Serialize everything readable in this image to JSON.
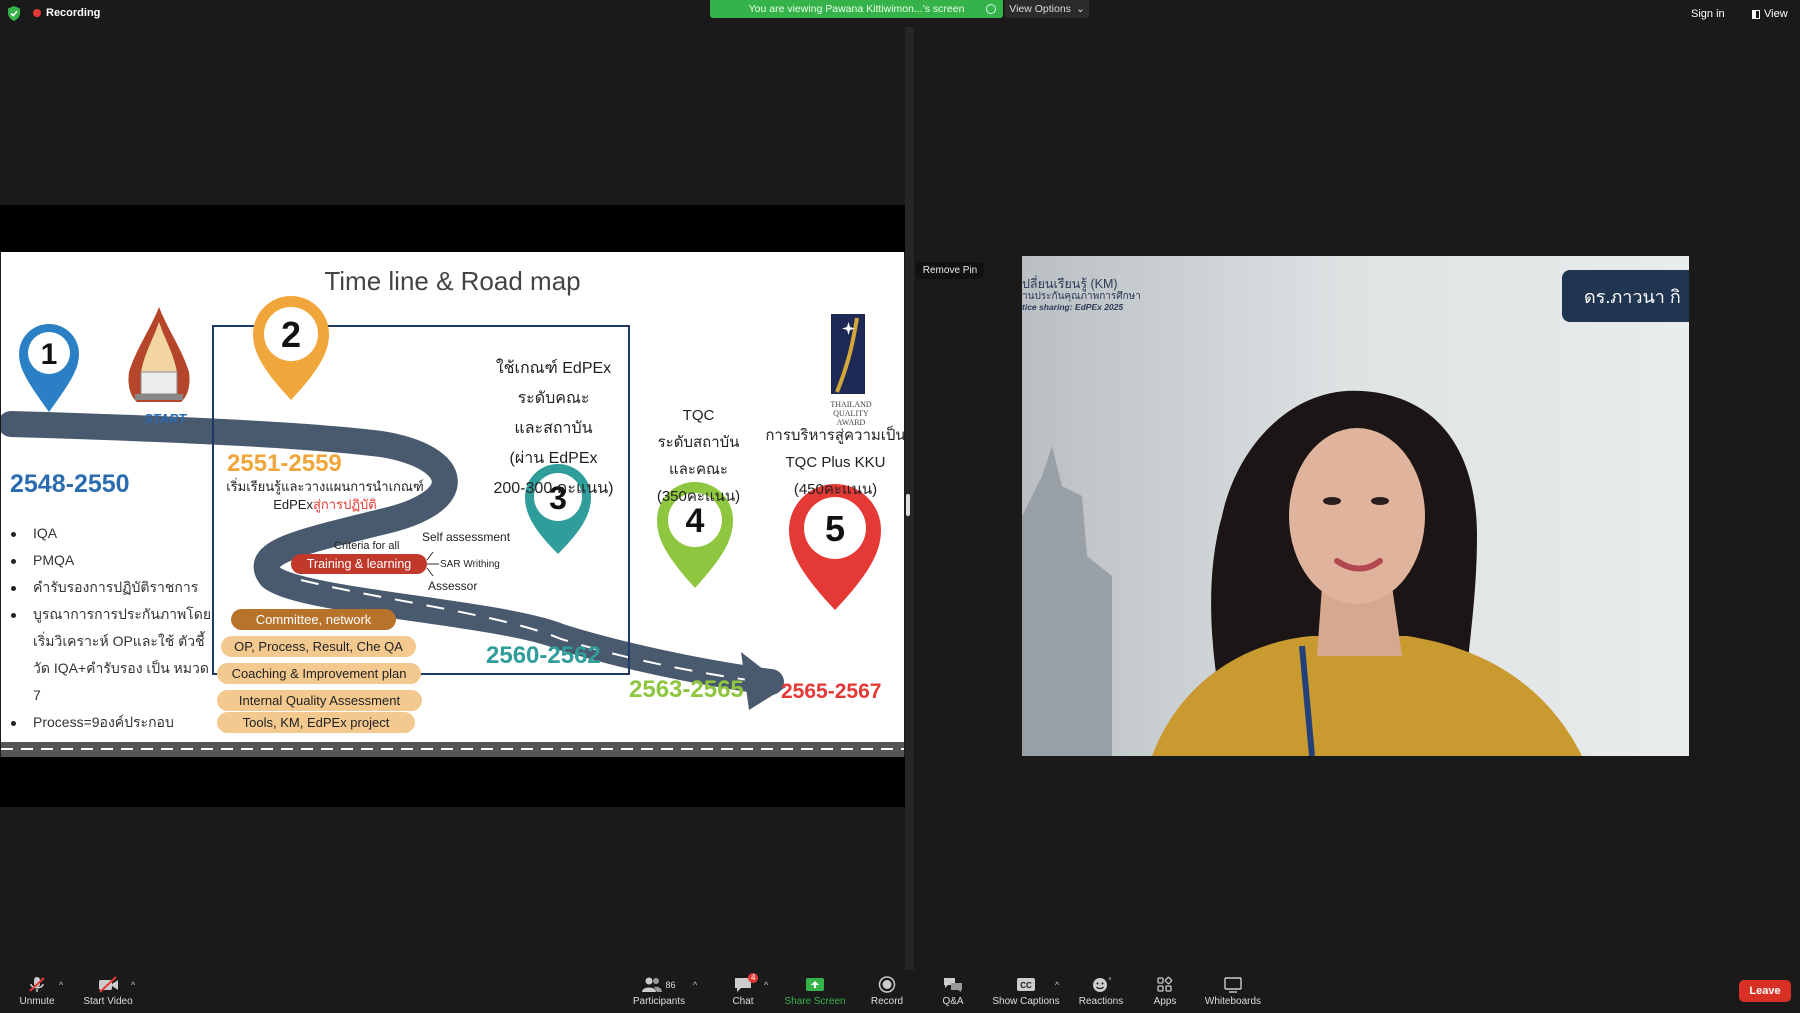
{
  "topbar": {
    "recording": "Recording",
    "viewing_notice": "You are viewing Pawana Kittiwimon...'s screen",
    "view_options": "View Options",
    "sign_in": "Sign in",
    "view": "View"
  },
  "slide": {
    "title": "Time line & Road map",
    "start_label": "START",
    "pins": [
      "1",
      "2",
      "3",
      "4",
      "5"
    ],
    "period1": {
      "years": "2548-2550",
      "bullets": [
        "IQA",
        "PMQA",
        "คำรับรองการปฏิบัติราชการ",
        "บูรณาการการประกันภาพโดยเริ่มวิเคราะห์ OPและใช้ ตัวชี้วัด IQA+คำรับรอง เป็น หมวด 7",
        "Process=9องค์ประกอบ"
      ]
    },
    "period2": {
      "years": "2551-2559",
      "text_a": "เริ่มเรียนรู้และวางแผนการนำเกณฑ์ EdPEx",
      "text_b": "สู่การปฏิบัติ",
      "criteria": "Criteria for all",
      "training": "Training & learning",
      "self_assessment": "Self assessment",
      "sar": "SAR Writhing",
      "assessor": "Assessor",
      "ovals": [
        "Committee, network",
        "OP, Process, Result, Che QA",
        "Coaching & Improvement plan",
        "Internal Quality Assessment",
        "Tools, KM, EdPEx project"
      ]
    },
    "period3": {
      "years": "2560-2562",
      "lines": [
        "ใช้เกณฑ์ EdPEx",
        "ระดับคณะ",
        "และสถาบัน",
        "(ผ่าน EdPEx",
        "200-300 คะแนน)"
      ]
    },
    "period4": {
      "years": "2563-2565",
      "lines": [
        "TQC",
        "ระดับสถาบัน",
        "และคณะ",
        "(350คะแนน)"
      ]
    },
    "period5": {
      "years": "2565-2567",
      "lines": [
        "การบริหารสู่ความเป็น",
        "TQC Plus KKU",
        "(450คะแนน)"
      ]
    },
    "tqa_logo_text": [
      "THAILAND",
      "QUALITY",
      "AWARD"
    ]
  },
  "video": {
    "remove_pin": "Remove Pin",
    "km_line1": "ปลี่ยนเรียนรู้ (KM)",
    "km_line2": "านประกันคุณภาพการศึกษา",
    "km_line3": "tice sharing: EdPEx 2025",
    "name_badge": "ดร.ภาวนา กิ"
  },
  "toolbar": {
    "unmute": "Unmute",
    "start_video": "Start Video",
    "participants": "Participants",
    "participants_count": "86",
    "chat": "Chat",
    "chat_badge": "4",
    "share_screen": "Share Screen",
    "record": "Record",
    "qa": "Q&A",
    "show_captions": "Show Captions",
    "reactions": "Reactions",
    "apps": "Apps",
    "whiteboards": "Whiteboards",
    "leave": "Leave"
  },
  "colors": {
    "pin1": "#2b80c5",
    "pin2": "#f0a63a",
    "pin3": "#2f9e9a",
    "pin4": "#8ec640",
    "pin5": "#e53935",
    "road": "#4a5a6e",
    "zoom_green": "#35b34a",
    "leave_red": "#d93025"
  }
}
